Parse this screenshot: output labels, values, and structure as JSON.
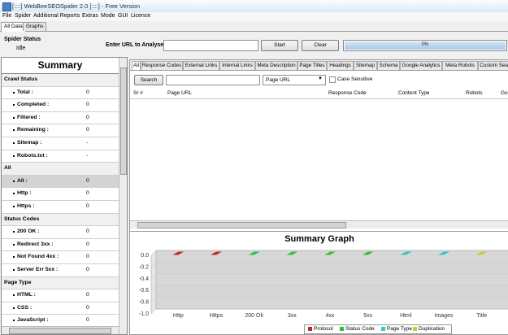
{
  "window": {
    "title": "[::::] WebBeeSEOSpider 2.0 [::::]  -  Free Version"
  },
  "menu": [
    "File",
    "Spider",
    "Additional Reports",
    "Extras",
    "Mode",
    "GUI",
    "Licence"
  ],
  "top_tabs": [
    "All Data",
    "Graphs"
  ],
  "status": {
    "label": "Spider Status",
    "value": "Idle"
  },
  "url_bar": {
    "label": "Enter URL to Analyse",
    "value": "",
    "start_label": "Start",
    "clear_label": "Clear"
  },
  "progress": {
    "percent": 0,
    "text": "0%"
  },
  "summary": {
    "title": "Summary",
    "rows": [
      {
        "type": "section",
        "label": "Crawl Status"
      },
      {
        "type": "item",
        "label": "Total :",
        "value": "0"
      },
      {
        "type": "item",
        "label": "Completed :",
        "value": "0"
      },
      {
        "type": "item",
        "label": "Filtered :",
        "value": "0"
      },
      {
        "type": "item",
        "label": "Remaining :",
        "value": "0"
      },
      {
        "type": "item",
        "label": "Sitemap :",
        "value": "-"
      },
      {
        "type": "item",
        "label": "Robots.txt :",
        "value": "-"
      },
      {
        "type": "section",
        "label": "All"
      },
      {
        "type": "item",
        "label": "All :",
        "value": "0",
        "selected": true
      },
      {
        "type": "item",
        "label": "Http :",
        "value": "0"
      },
      {
        "type": "item",
        "label": "Https :",
        "value": "0"
      },
      {
        "type": "section",
        "label": "Status Codes"
      },
      {
        "type": "item",
        "label": "200 OK :",
        "value": "0"
      },
      {
        "type": "item",
        "label": "Redirect 3xx :",
        "value": "0"
      },
      {
        "type": "item",
        "label": "Not Found 4xx :",
        "value": "0"
      },
      {
        "type": "item",
        "label": "Server Err 5xx :",
        "value": "0"
      },
      {
        "type": "section",
        "label": "Page Type"
      },
      {
        "type": "item",
        "label": "HTML :",
        "value": "0"
      },
      {
        "type": "item",
        "label": "CSS :",
        "value": "0"
      },
      {
        "type": "item",
        "label": "JavaScript :",
        "value": "0"
      },
      {
        "type": "item",
        "label": "Images :",
        "value": "0"
      }
    ]
  },
  "data_tabs": [
    "All",
    "Response Codes",
    "External Links",
    "Internal Links",
    "Meta Description",
    "Page Titles",
    "Headings",
    "Sitemap",
    "Schema",
    "Google Analytics",
    "Meta Robots",
    "Custom Search"
  ],
  "filter": {
    "search_label": "Search",
    "search_value": "",
    "select_value": "Page URL",
    "case_label": "Case Sensitive"
  },
  "grid_columns": [
    "Sr #",
    "Page URL",
    "Response Code",
    "Content Type",
    "Robots",
    "Go"
  ],
  "colors": {
    "protocol": "#c0282d",
    "status": "#2fbf3b",
    "pagetype": "#36c3c9",
    "duplication": "#d0c92e"
  },
  "chart_data": {
    "type": "bar",
    "title": "Summary Graph",
    "categories": [
      "Http",
      "Https",
      "200 Ok",
      "3xx",
      "4xx",
      "5xx",
      "Html",
      "Images",
      "Title"
    ],
    "series": [
      {
        "name": "Protocol",
        "values": [
          0,
          0,
          null,
          null,
          null,
          null,
          null,
          null,
          null
        ]
      },
      {
        "name": "Status Code",
        "values": [
          null,
          null,
          0,
          0,
          0,
          0,
          null,
          null,
          null
        ]
      },
      {
        "name": "Page Type",
        "values": [
          null,
          null,
          null,
          null,
          null,
          null,
          0,
          0,
          null
        ]
      },
      {
        "name": "Duplication",
        "values": [
          null,
          null,
          null,
          null,
          null,
          null,
          null,
          null,
          0
        ]
      }
    ],
    "yticks": [
      "0.0",
      "-0.2",
      "-0.4",
      "-0.6",
      "-0.8",
      "-1.0"
    ],
    "ylim": [
      -1.0,
      0.0
    ],
    "grid": true,
    "legend": "bottom"
  }
}
